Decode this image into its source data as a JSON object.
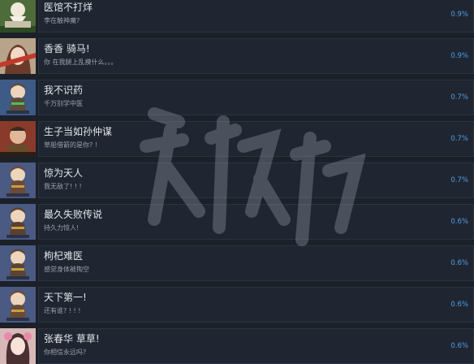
{
  "achievements": [
    {
      "title": "医馆不打烊",
      "desc": "李在触神魔?",
      "pct": "0.9%",
      "thumb": "old-sage",
      "bg": "#4e6b3a",
      "fg": "#e8e0c8"
    },
    {
      "title": "香香 骑马!",
      "desc": "你 在我腿上乱摸什么。。。",
      "pct": "0.9%",
      "thumb": "girl-portrait",
      "bg": "#b8a48a",
      "fg": "#6b3b2a"
    },
    {
      "title": "我不识药",
      "desc": "千万别学中医",
      "pct": "0.7%",
      "thumb": "chibi-green",
      "bg": "#3e5a86",
      "fg": "#5e4a3a"
    },
    {
      "title": "生子当如孙仲谋",
      "desc": "草船借箭的是你? !",
      "pct": "0.7%",
      "thumb": "warrior-red",
      "bg": "#8a3a2a",
      "fg": "#3a2a22"
    },
    {
      "title": "惊为天人",
      "desc": "我无敌了! ! !",
      "pct": "0.7%",
      "thumb": "chibi-blue",
      "bg": "#4a5a82",
      "fg": "#6a4a3a"
    },
    {
      "title": "最久失败传说",
      "desc": "持久力惊人!",
      "pct": "0.6%",
      "thumb": "chibi-blue",
      "bg": "#4a5a82",
      "fg": "#5a4030"
    },
    {
      "title": "枸杞难医",
      "desc": "感觉身体被掏空",
      "pct": "0.6%",
      "thumb": "chibi-blue",
      "bg": "#4a5a82",
      "fg": "#5a4534"
    },
    {
      "title": "天下第一!",
      "desc": "还有谁? ! ! !",
      "pct": "0.6%",
      "thumb": "chibi-blue",
      "bg": "#4a5a82",
      "fg": "#6a4a38"
    },
    {
      "title": "张春华 草草!",
      "desc": "你相信永远吗?",
      "pct": "0.6%",
      "thumb": "girl-pink",
      "bg": "#d8b8b8",
      "fg": "#4a3030"
    }
  ]
}
